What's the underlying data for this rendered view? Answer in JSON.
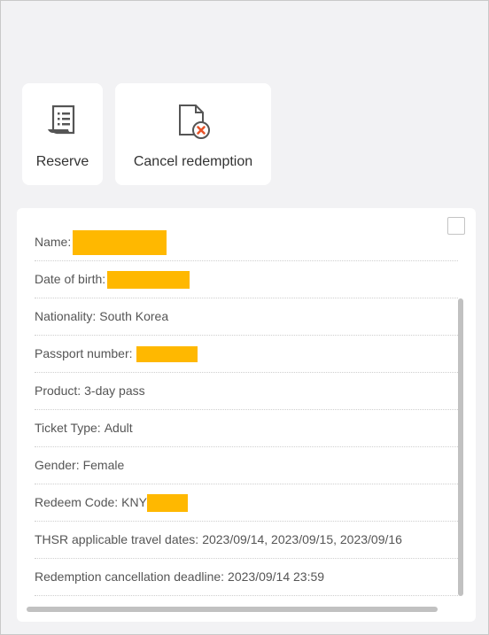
{
  "actions": {
    "reserve_label": "Reserve",
    "cancel_label": "Cancel redemption"
  },
  "details": [
    {
      "label": "Name:",
      "value": "",
      "redacted": true
    },
    {
      "label": "Date of birth:",
      "value": "",
      "redacted": true
    },
    {
      "label": "Nationality:",
      "value": "South Korea",
      "redacted": false
    },
    {
      "label": "Passport number:",
      "value": "",
      "redacted": true
    },
    {
      "label": "Product:",
      "value": "3-day pass",
      "redacted": false
    },
    {
      "label": "Ticket Type:",
      "value": "Adult",
      "redacted": false
    },
    {
      "label": "Gender:",
      "value": "Female",
      "redacted": false
    },
    {
      "label": "Redeem Code:",
      "value": "KNY",
      "redacted": true
    },
    {
      "label": "THSR applicable travel dates:",
      "value": "2023/09/14, 2023/09/15, 2023/09/16",
      "redacted": false
    },
    {
      "label": "Redemption cancellation deadline:",
      "value": "2023/09/14 23:59",
      "redacted": false
    }
  ],
  "colors": {
    "redaction": "#ffb800",
    "cancel_badge": "#e8542a",
    "icon_stroke": "#555555"
  },
  "icons": {
    "reserve": "receipt-icon",
    "cancel": "document-cancel-icon"
  }
}
